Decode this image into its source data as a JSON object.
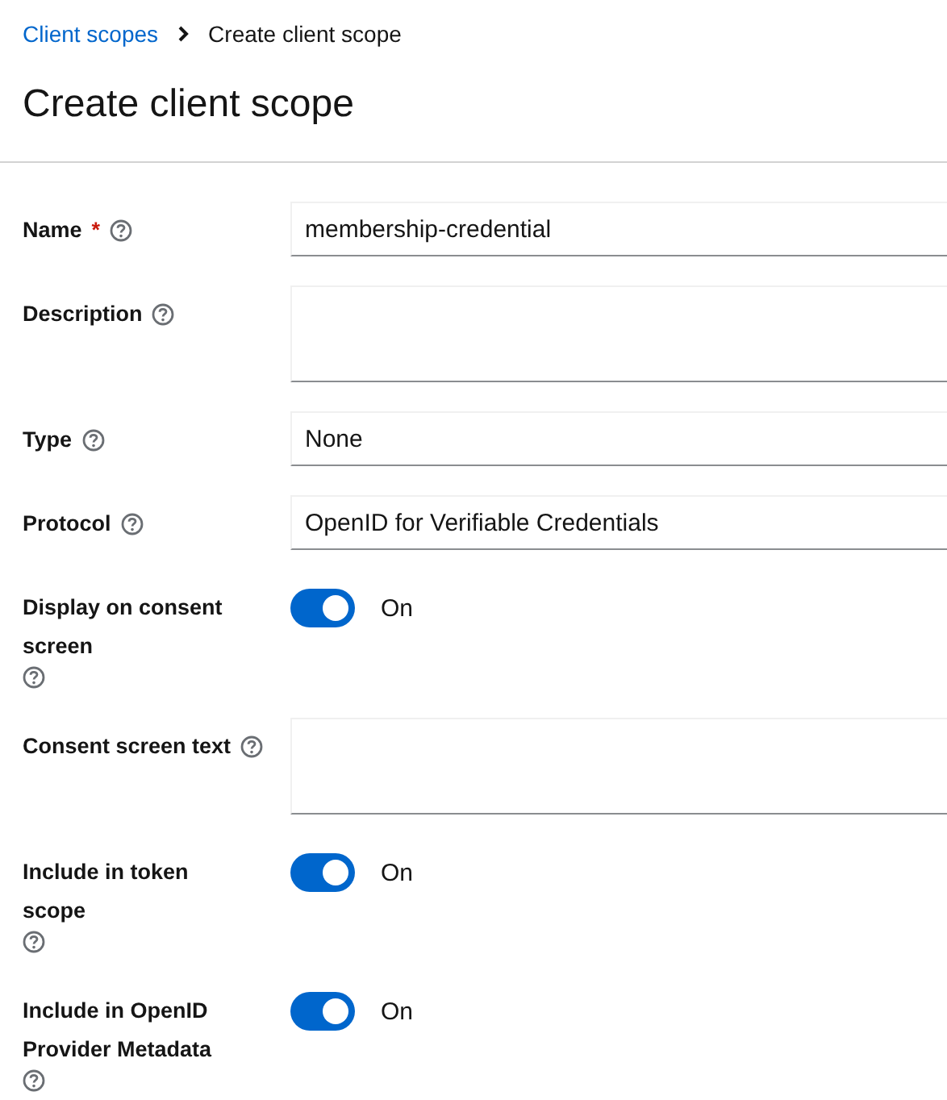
{
  "breadcrumb": [
    {
      "label": "Client scopes",
      "kind": "link"
    },
    {
      "label": "Create client scope",
      "kind": "current"
    }
  ],
  "title": "Create client scope",
  "fields": [
    {
      "kind": "text",
      "label": "Name",
      "required_mark": "*",
      "value": "membership-credential"
    },
    {
      "kind": "textarea",
      "label": "Description"
    },
    {
      "kind": "select",
      "label": "Type",
      "value": "None"
    },
    {
      "kind": "select",
      "label": "Protocol",
      "value": "OpenID for Verifiable Credentials"
    },
    {
      "kind": "switch",
      "label": "Display on consent screen",
      "on": true,
      "state_text": "On"
    },
    {
      "kind": "textarea",
      "label": "Consent screen text"
    },
    {
      "kind": "switch",
      "label": "Include in token scope",
      "on": true,
      "state_text": "On"
    },
    {
      "kind": "switch",
      "label": "Include in OpenID Provider Metadata",
      "on": true,
      "state_text": "On"
    }
  ]
}
